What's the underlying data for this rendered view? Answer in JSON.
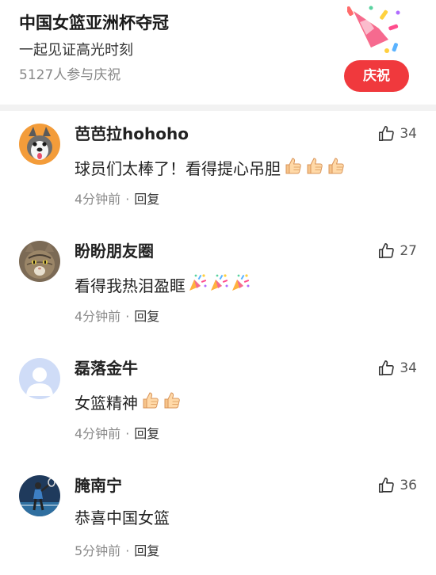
{
  "header": {
    "title": "中国女篮亚洲杯夺冠",
    "subtitle": "一起见证高光时刻",
    "participants": "5127人参与庆祝",
    "celebrate_label": "庆祝",
    "icon": "party-popper-icon"
  },
  "colors": {
    "accent": "#f0393d",
    "divider": "#f2f2f2",
    "meta_text": "#8a8a8a"
  },
  "comments": [
    {
      "username": "芭芭拉hohoho",
      "text": "球员们太棒了！看得提心吊胆",
      "emoji_icon": "thumbs-up-emoji",
      "emoji_count": 3,
      "likes": "34",
      "time": "4分钟前",
      "separator": "·",
      "reply": "回复",
      "avatar": "husky-dog-avatar"
    },
    {
      "username": "盼盼朋友圈",
      "text": "看得我热泪盈眶",
      "emoji_icon": "party-popper-emoji",
      "emoji_count": 3,
      "likes": "27",
      "time": "4分钟前",
      "separator": "·",
      "reply": "回复",
      "avatar": "cat-avatar"
    },
    {
      "username": "磊落金牛",
      "text": "女篮精神",
      "emoji_icon": "thumbs-up-emoji",
      "emoji_count": 2,
      "likes": "34",
      "time": "4分钟前",
      "separator": "·",
      "reply": "回复",
      "avatar": "default-user-avatar"
    },
    {
      "username": "腌南宁",
      "text": "恭喜中国女篮",
      "emoji_icon": "",
      "emoji_count": 0,
      "likes": "36",
      "time": "5分钟前",
      "separator": "·",
      "reply": "回复",
      "avatar": "tennis-player-avatar"
    }
  ]
}
